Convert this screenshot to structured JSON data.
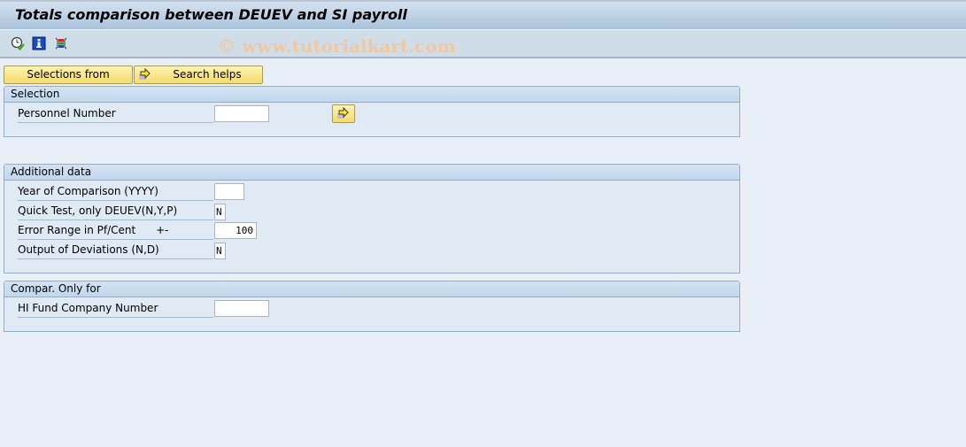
{
  "window": {
    "title": "Totals comparison between DEUEV and SI payroll"
  },
  "toolbar": {
    "icons": [
      {
        "name": "execute-clock-icon",
        "label": "Execute"
      },
      {
        "name": "info-icon",
        "label": "Program documentation"
      },
      {
        "name": "selection-options-icon",
        "label": "Selection options"
      }
    ],
    "watermark": "© www.tutorialkart.com"
  },
  "buttons": {
    "selections_from": "Selections from",
    "search_helps": "Search helps"
  },
  "groups": {
    "selection": {
      "title": "Selection",
      "fields": [
        {
          "label": "Personnel Number",
          "value": ""
        }
      ]
    },
    "additional": {
      "title": "Additional data",
      "fields": [
        {
          "label": "Year of Comparison (YYYY)",
          "value": ""
        },
        {
          "label": "Quick Test, only DEUEV(N,Y,P)",
          "value": "N"
        },
        {
          "label": "Error Range in Pf/Cent      +-",
          "value": "100"
        },
        {
          "label": "Output of Deviations (N,D)",
          "value": "N"
        }
      ]
    },
    "compar": {
      "title": "Compar. Only for",
      "fields": [
        {
          "label": "HI Fund Company Number",
          "value": ""
        }
      ]
    }
  },
  "colors": {
    "button_yellow": "#f5dc6c",
    "background": "#e8eff7",
    "group_header": "#c2d7ec"
  }
}
